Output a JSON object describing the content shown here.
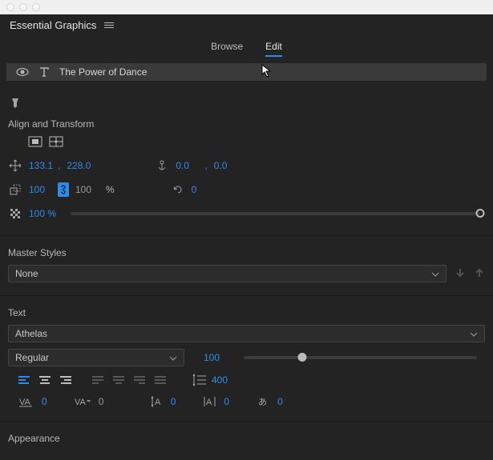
{
  "panel_title": "Essential Graphics",
  "tabs": {
    "browse": "Browse",
    "edit": "Edit"
  },
  "layer": {
    "name": "The Power of Dance"
  },
  "align_transform": {
    "label": "Align and Transform",
    "pos_x": "133.1",
    "pos_comma": ",",
    "pos_y": "228.0",
    "anchor_x": "0.0",
    "anchor_comma": ",",
    "anchor_y": "0.0",
    "scale_w": "100",
    "scale_h": "100",
    "percent": "%",
    "rotation": "0",
    "opacity": "100 %"
  },
  "master_styles": {
    "label": "Master Styles",
    "value": "None"
  },
  "text": {
    "label": "Text",
    "font": "Athelas",
    "weight": "Regular",
    "size": "100",
    "leading": "400",
    "tracking1": "0",
    "tracking2": "0",
    "baseline": "0",
    "tsume": "0",
    "kerning": "0"
  },
  "appearance": {
    "label": "Appearance"
  }
}
